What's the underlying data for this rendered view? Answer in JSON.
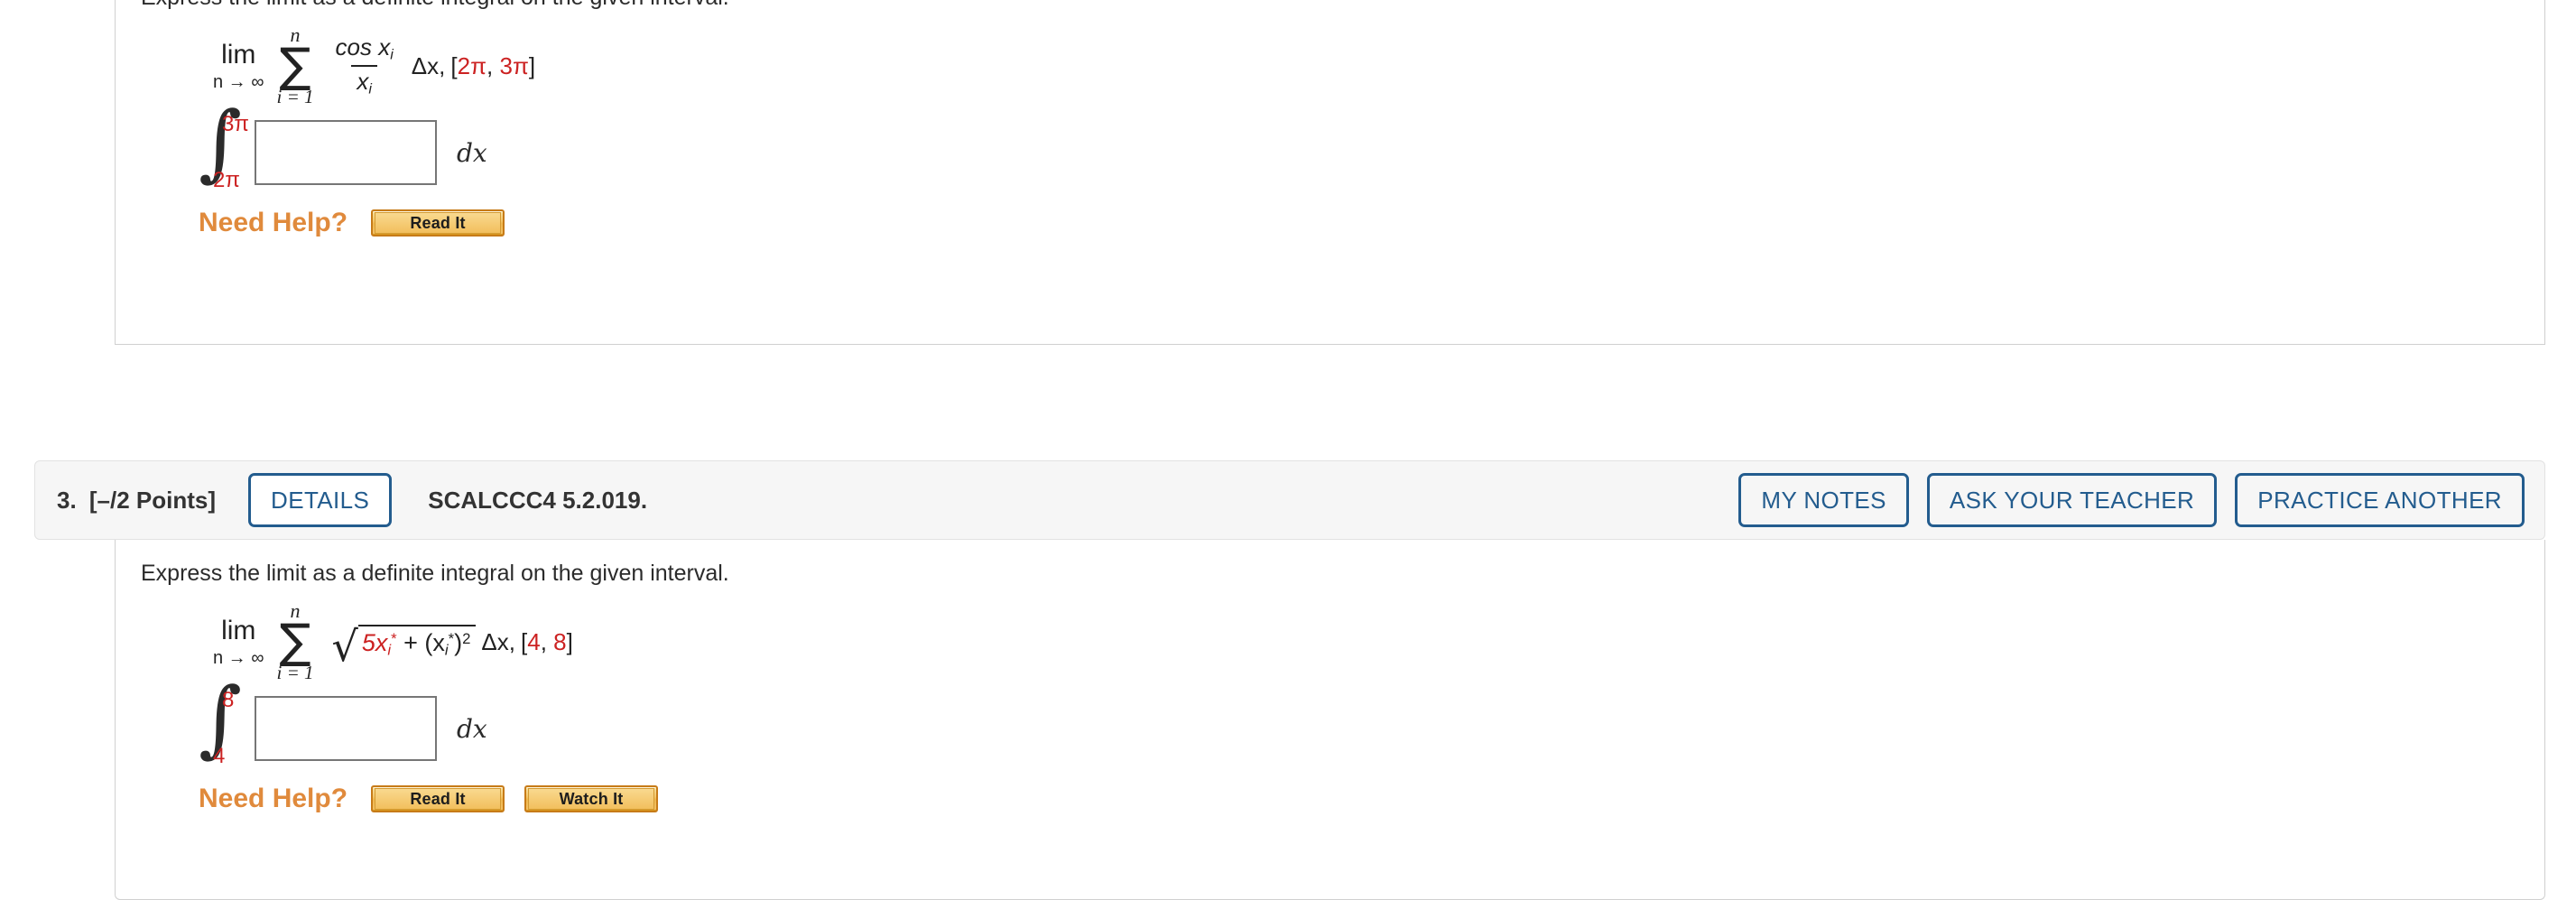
{
  "colors": {
    "accent_blue": "#235c8e",
    "need_help_orange": "#e08a3c",
    "math_red": "#cc2222",
    "header_bg": "#f6f6f6",
    "card_border": "#d0d0d0"
  },
  "problems": [
    {
      "id": "problem-2-partial",
      "header_visible": false,
      "prompt": "Express the limit as a definite integral on the given interval.",
      "limit": {
        "lim_text": "lim",
        "lim_sub": "n → ∞",
        "sigma_top": "n",
        "sigma_bottom": "i = 1",
        "numerator": "cos x",
        "numerator_sub": "i",
        "denominator": "x",
        "denominator_sub": "i",
        "delta": "Δx,",
        "interval_open": "[",
        "interval_a": "2π",
        "interval_comma": ",",
        "interval_b": "3π",
        "interval_close": "]"
      },
      "integral": {
        "upper": "3π",
        "lower": "2π",
        "answer_value": "",
        "answer_placeholder": "",
        "differential": "dx"
      },
      "help": {
        "label": "Need Help?",
        "buttons": [
          "Read It"
        ]
      }
    },
    {
      "id": "problem-3",
      "header_visible": true,
      "header": {
        "number": "3.",
        "points": "[–/2 Points]",
        "details_label": "DETAILS",
        "question_code": "SCALCCC4 5.2.019.",
        "right_buttons": [
          "MY NOTES",
          "ASK YOUR TEACHER",
          "PRACTICE ANOTHER"
        ]
      },
      "prompt": "Express the limit as a definite integral on the given interval.",
      "limit": {
        "lim_text": "lim",
        "lim_sub": "n → ∞",
        "sigma_top": "n",
        "sigma_bottom": "i = 1",
        "radicand_red": "5x",
        "radicand_red_sub": "i",
        "radicand_red_star": "*",
        "radicand_plus": " + (x",
        "radicand_sub2": "i",
        "radicand_star2": "*",
        "radicand_close": ")",
        "radicand_pow": "2",
        "delta": "Δx,",
        "interval_open": "[",
        "interval_a": "4",
        "interval_comma": ",",
        "interval_b": "8",
        "interval_close": "]"
      },
      "integral": {
        "upper": "8",
        "lower": "4",
        "answer_value": "",
        "answer_placeholder": "",
        "differential": "dx"
      },
      "help": {
        "label": "Need Help?",
        "buttons": [
          "Read It",
          "Watch It"
        ]
      }
    }
  ]
}
